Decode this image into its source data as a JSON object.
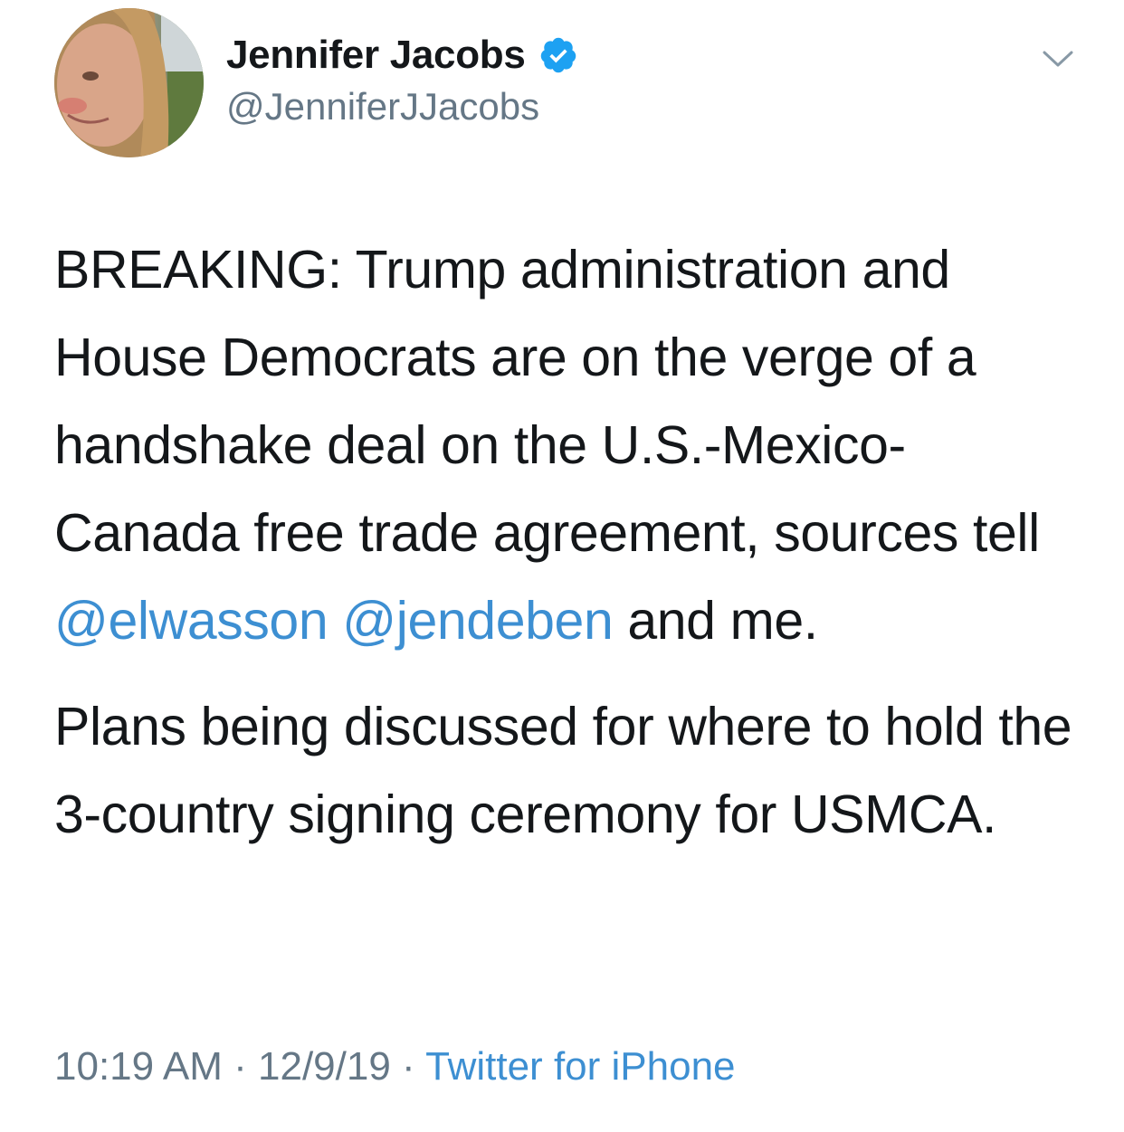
{
  "author": {
    "display_name": "Jennifer Jacobs",
    "handle": "@JenniferJJacobs",
    "verified_icon": "verified-badge-icon",
    "avatar": "profile-photo"
  },
  "header": {
    "more_icon": "chevron-down-icon"
  },
  "tweet": {
    "paragraph_1": {
      "text_before": "BREAKING: Trump administration and House Democrats are on the verge of a handshake deal on the U.S.-Mexico-Canada free trade agreement, sources tell ",
      "mention_1": "@elwasson",
      "space": " ",
      "mention_2": "@jendeben",
      "text_after": " and me."
    },
    "paragraph_2": "Plans being discussed for where to hold the 3-country signing ceremony for USMCA."
  },
  "meta": {
    "time": "10:19 AM",
    "sep1": " · ",
    "date": "12/9/19",
    "sep2": " · ",
    "source": "Twitter for iPhone"
  },
  "colors": {
    "link": "#3d8fd2",
    "text": "#14171a",
    "secondary": "#657786",
    "verified": "#1da1f2"
  }
}
